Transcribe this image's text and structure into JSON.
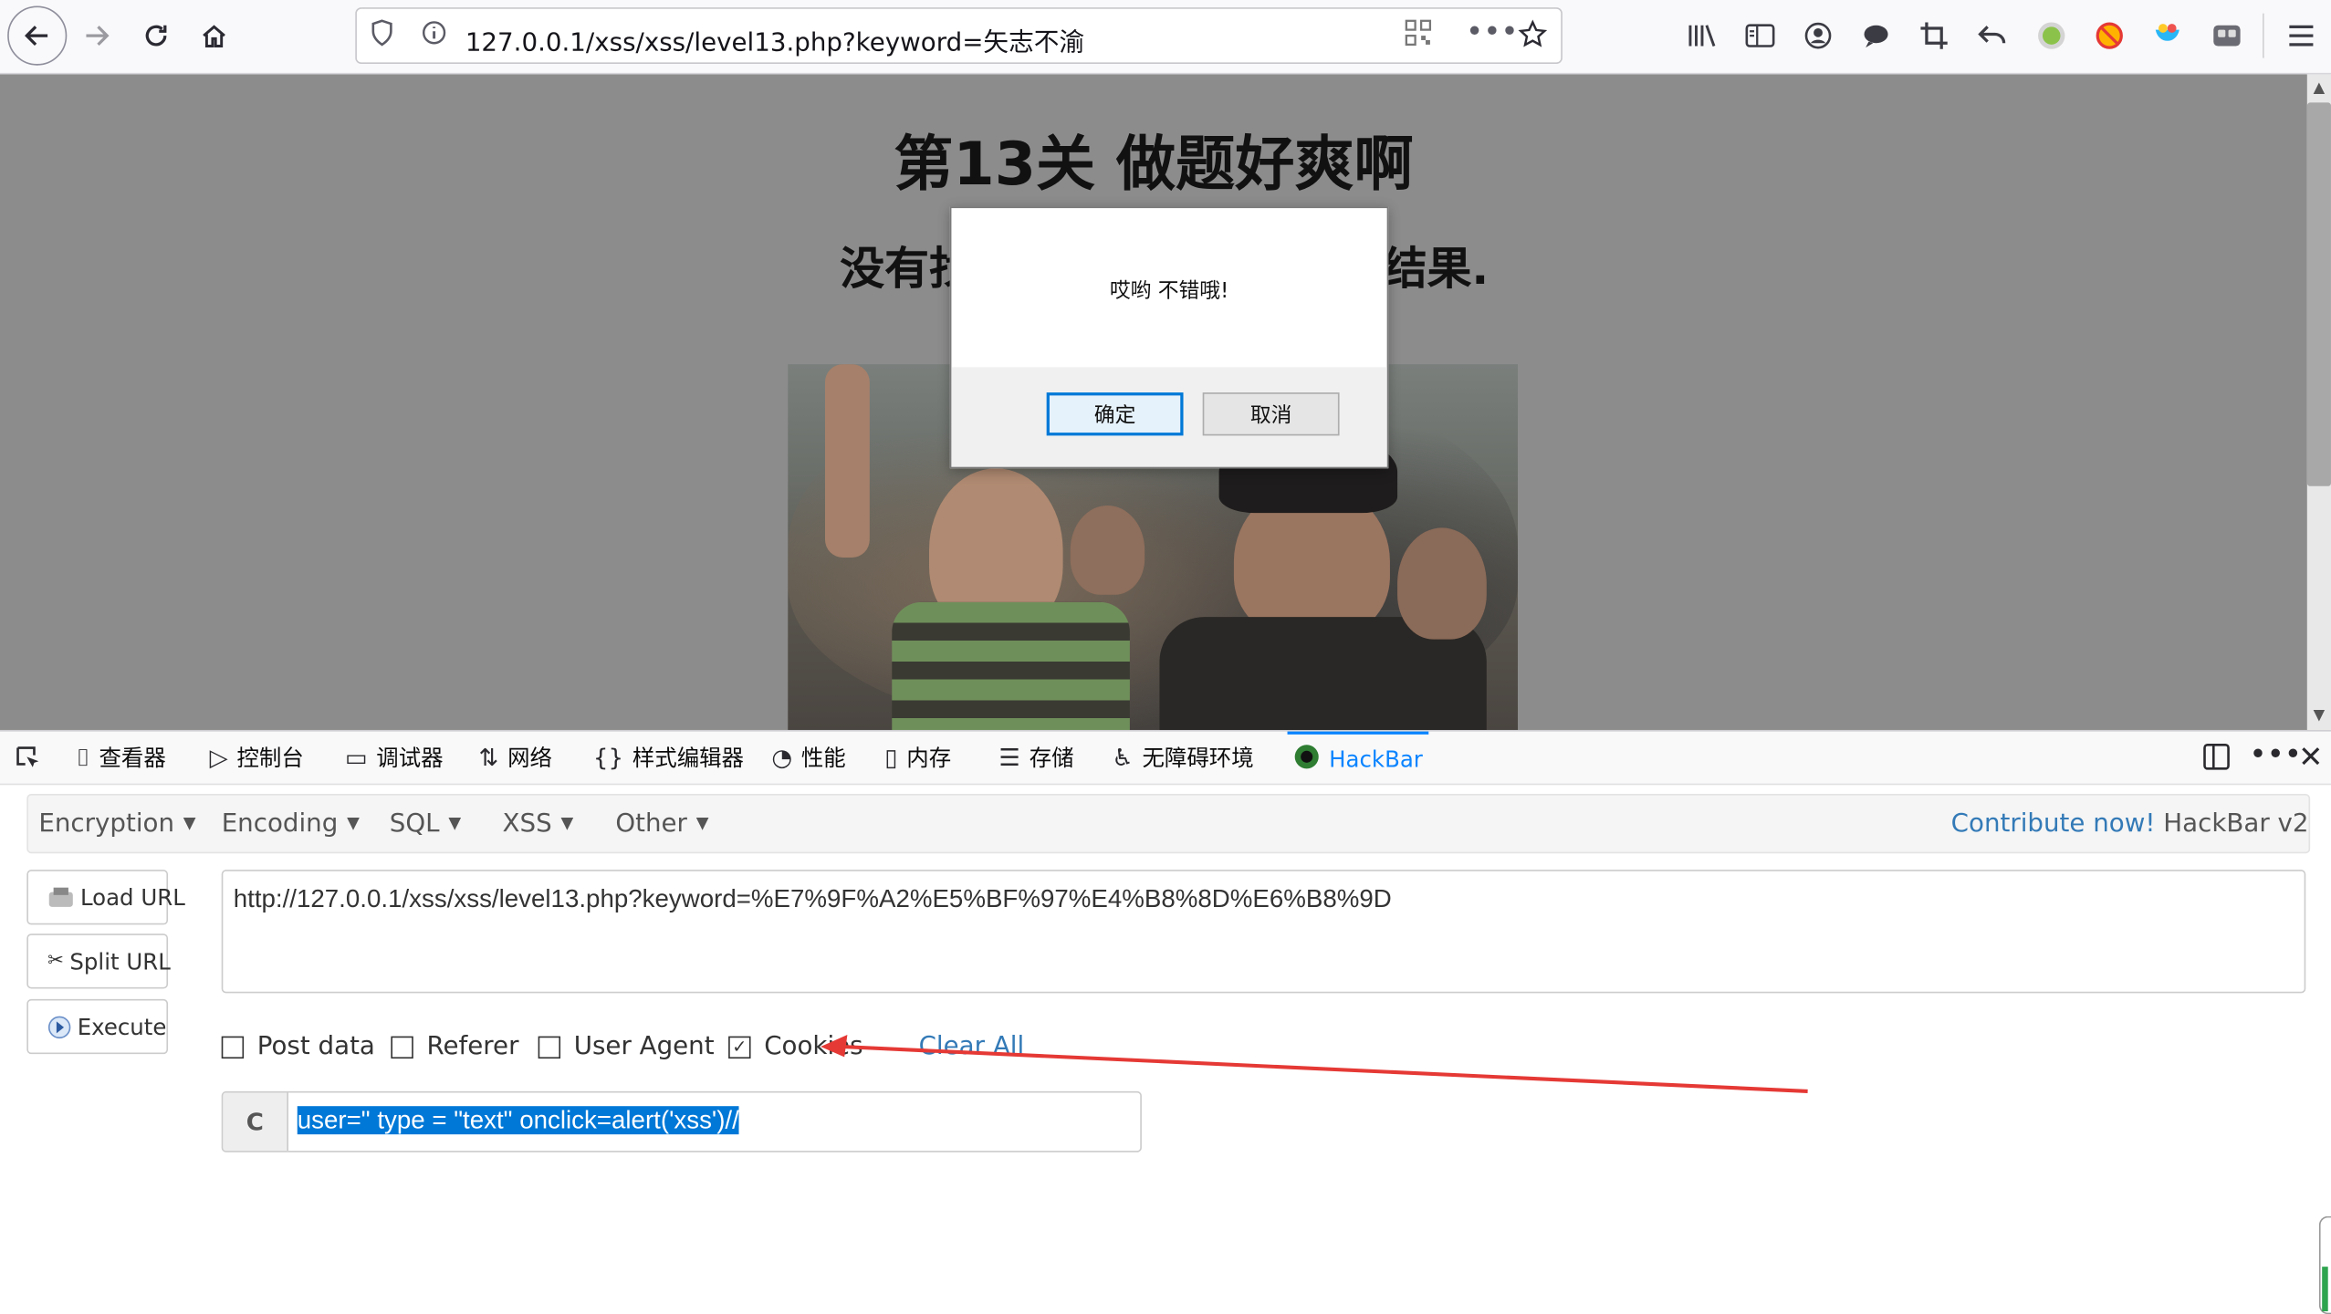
{
  "browser": {
    "url": "127.0.0.1/xss/xss/level13.php?keyword=矢志不渝"
  },
  "page": {
    "title": "第13关 做题好爽啊",
    "subtitle_left": "没有找",
    "subtitle_right": "结果."
  },
  "dialog": {
    "message": "哎哟 不错哦!",
    "ok_label": "确定",
    "cancel_label": "取消"
  },
  "devtools": {
    "tabs": [
      {
        "label": "查看器",
        "icon": "inspector-icon"
      },
      {
        "label": "控制台",
        "icon": "console-icon"
      },
      {
        "label": "调试器",
        "icon": "debugger-icon"
      },
      {
        "label": "网络",
        "icon": "network-icon"
      },
      {
        "label": "样式编辑器",
        "icon": "style-editor-icon"
      },
      {
        "label": "性能",
        "icon": "performance-icon"
      },
      {
        "label": "内存",
        "icon": "memory-icon"
      },
      {
        "label": "存储",
        "icon": "storage-icon"
      },
      {
        "label": "无障碍环境",
        "icon": "accessibility-icon"
      },
      {
        "label": "HackBar",
        "icon": "hackbar-icon"
      }
    ],
    "active_tab": "HackBar"
  },
  "hackbar": {
    "menus": [
      "Encryption",
      "Encoding",
      "SQL",
      "XSS",
      "Other"
    ],
    "contribute_link": "Contribute now!",
    "version": "HackBar v2",
    "load_url": "Load URL",
    "split_url": "Split URL",
    "execute": "Execute",
    "url_value": "http://127.0.0.1/xss/xss/level13.php?keyword=%E7%9F%A2%E5%BF%97%E4%B8%8D%E6%B8%9D",
    "options": [
      {
        "label": "Post data",
        "checked": false
      },
      {
        "label": "Referer",
        "checked": false
      },
      {
        "label": "User Agent",
        "checked": false
      },
      {
        "label": "Cookies",
        "checked": true
      }
    ],
    "clear_all": "Clear All",
    "cookie_label": "C",
    "cookie_value": "user=\" type = \"text\" onclick=alert('xss')//"
  },
  "colors": {
    "accent": "#0a84ff",
    "link": "#337ab7",
    "selection": "#0078d7",
    "annotation_arrow": "#e53935"
  }
}
